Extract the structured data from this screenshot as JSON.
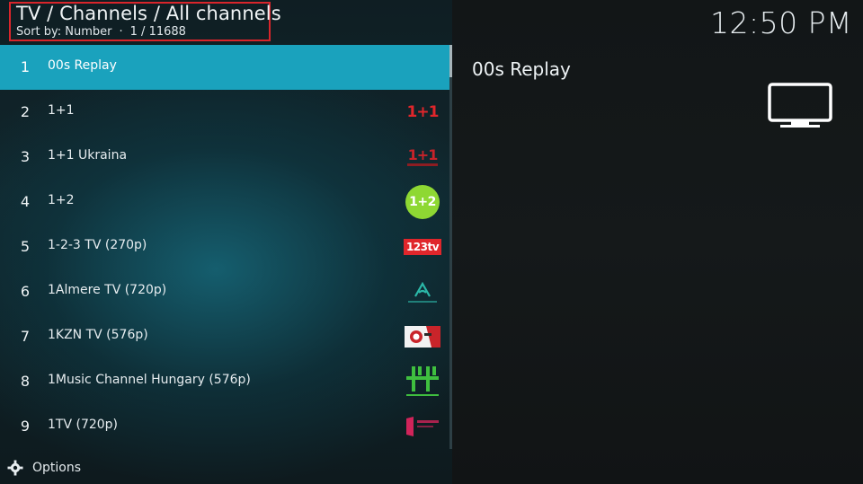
{
  "header": {
    "title": "TV / Channels / All channels",
    "sort_label": "Sort by: Number",
    "position": "1 / 11688"
  },
  "clock": "12:50 PM",
  "channels": [
    {
      "number": "1",
      "name": "00s Replay",
      "selected": true,
      "logo": "none"
    },
    {
      "number": "2",
      "name": "1+1",
      "logo": "1plus1-logo",
      "logo_text": "1+1",
      "logo_color": "#e0262b"
    },
    {
      "number": "3",
      "name": "1+1 Ukraina",
      "logo": "1plus1-ukraina-logo",
      "logo_text": "1+1",
      "logo_color": "#c8232a"
    },
    {
      "number": "4",
      "name": "1+2",
      "logo": "1plus2-logo",
      "logo_text": "1+2",
      "logo_color": "#8ed833"
    },
    {
      "number": "5",
      "name": "1-2-3 TV (270p)",
      "logo": "123tv-logo",
      "logo_text": "123tv",
      "logo_color": "#e0262b"
    },
    {
      "number": "6",
      "name": "1Almere TV (720p)",
      "logo": "1almere-logo",
      "logo_color": "#2bb8a8"
    },
    {
      "number": "7",
      "name": "1KZN TV (576p)",
      "logo": "1kzn-logo",
      "logo_color": "#d02a2a"
    },
    {
      "number": "8",
      "name": "1Music Channel Hungary (576p)",
      "logo": "1music-logo",
      "logo_color": "#3fbf3f"
    },
    {
      "number": "9",
      "name": "1TV (720p)",
      "logo": "1tv-logo",
      "logo_color": "#d0245a"
    }
  ],
  "footer": {
    "options_label": "Options",
    "options_icon": "gear-icon"
  },
  "info": {
    "title": "00s Replay",
    "icon": "tv-icon"
  },
  "colors": {
    "selection": "#1aa2bd",
    "highlight_border": "#d9252b"
  }
}
